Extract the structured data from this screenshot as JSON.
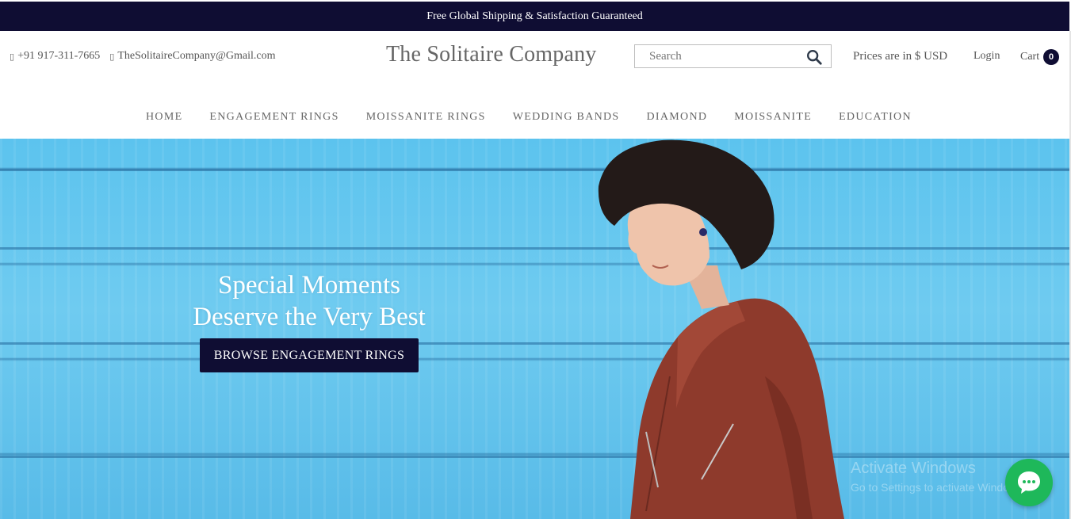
{
  "announcement": "Free Global Shipping & Satisfaction Guaranteed",
  "contact": {
    "phone": "+91 917-311-7665",
    "email": "TheSolitaireCompany@Gmail.com",
    "phone_icon": "phone-icon",
    "email_icon": "envelope-icon"
  },
  "brand": "The Solitaire Company",
  "search": {
    "placeholder": "Search",
    "icon": "search-icon"
  },
  "currency": "Prices are in $ USD",
  "login": "Login",
  "cart": {
    "label": "Cart",
    "count": "0"
  },
  "nav": [
    "HOME",
    "ENGAGEMENT RINGS",
    "MOISSANITE RINGS",
    "WEDDING BANDS",
    "DIAMOND",
    "MOISSANITE",
    "EDUCATION"
  ],
  "hero": {
    "line1": "Special Moments",
    "line2": "Deserve the Very Best",
    "cta": "BROWSE ENGAGEMENT RINGS"
  },
  "watermark": {
    "line1": "Activate Windows",
    "line2": "Go to Settings to activate Windows."
  },
  "chat": {
    "icon": "chat-bubble-icon"
  },
  "colors": {
    "navy": "#0f0d33",
    "hero_blue": "#5cc3ee",
    "chat_green": "#1eb85a",
    "jacket": "#8e3a2c"
  }
}
